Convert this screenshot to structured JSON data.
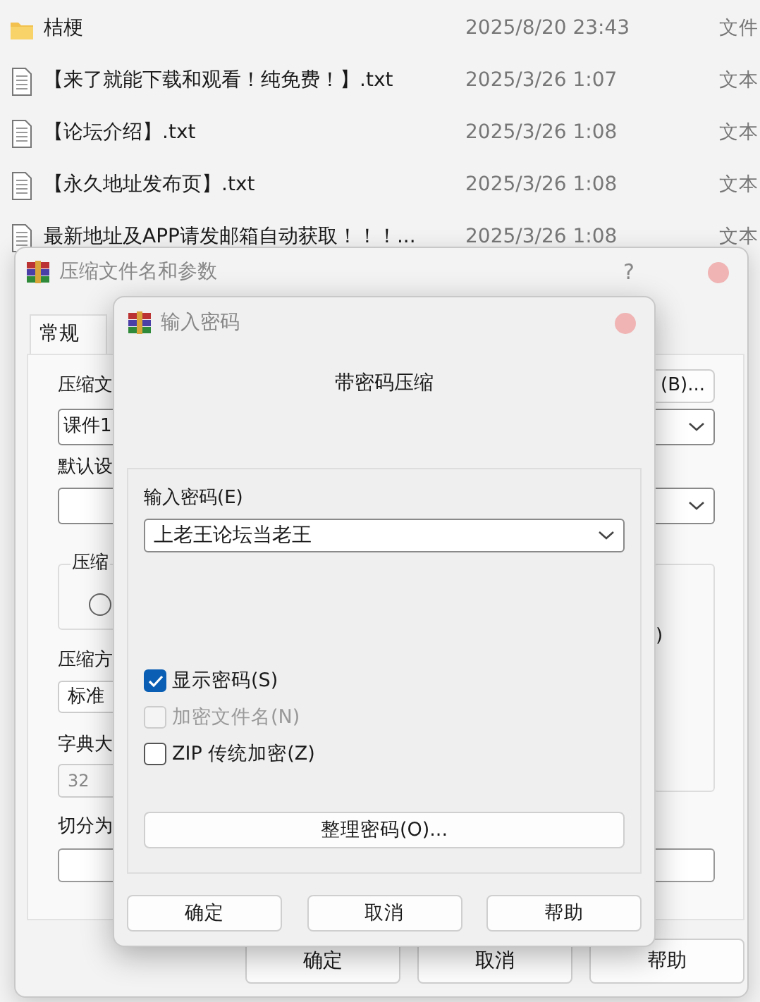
{
  "files": [
    {
      "kind": "folder",
      "name": "桔梗",
      "modified": "2025/8/20 23:43",
      "type": "文件"
    },
    {
      "kind": "text",
      "name": "【来了就能下载和观看！纯免费！】.txt",
      "modified": "2025/3/26 1:07",
      "type": "文本"
    },
    {
      "kind": "text",
      "name": "【论坛介绍】.txt",
      "modified": "2025/3/26 1:08",
      "type": "文本"
    },
    {
      "kind": "text",
      "name": "【永久地址发布页】.txt",
      "modified": "2025/3/26 1:08",
      "type": "文本"
    },
    {
      "kind": "text",
      "name": "最新地址及APP请发邮箱自动获取！！！...",
      "modified": "2025/3/26 1:08",
      "type": "文本"
    }
  ],
  "back_dialog": {
    "title": "压缩文件名和参数",
    "help": "?",
    "tabs": [
      {
        "label": "常规",
        "selected": true
      }
    ],
    "archive_label": "压缩文",
    "browse_button": "(B)...",
    "archive_name": "课件1",
    "profile_label": "默认设",
    "format_label": "压缩",
    "format_radio": {
      "selected": false
    },
    "group_fragment": ")",
    "method_label": "压缩方",
    "method": "标准",
    "dict_label": "字典大",
    "dict": "32",
    "split_label": "切分为",
    "buttons": [
      "确定",
      "取消",
      "帮助"
    ]
  },
  "password_dialog": {
    "title": "输入密码",
    "heading": "带密码压缩",
    "password_label": "输入密码(E)",
    "password": "上老王论坛当老王",
    "options": [
      {
        "label": "显示密码(S)",
        "checked": true,
        "disabled": false
      },
      {
        "label": "加密文件名(N)",
        "checked": false,
        "disabled": true
      },
      {
        "label": "ZIP 传统加密(Z)",
        "checked": false,
        "disabled": false
      }
    ],
    "organize_button": "整理密码(O)...",
    "buttons": [
      "确定",
      "取消",
      "帮助"
    ]
  }
}
